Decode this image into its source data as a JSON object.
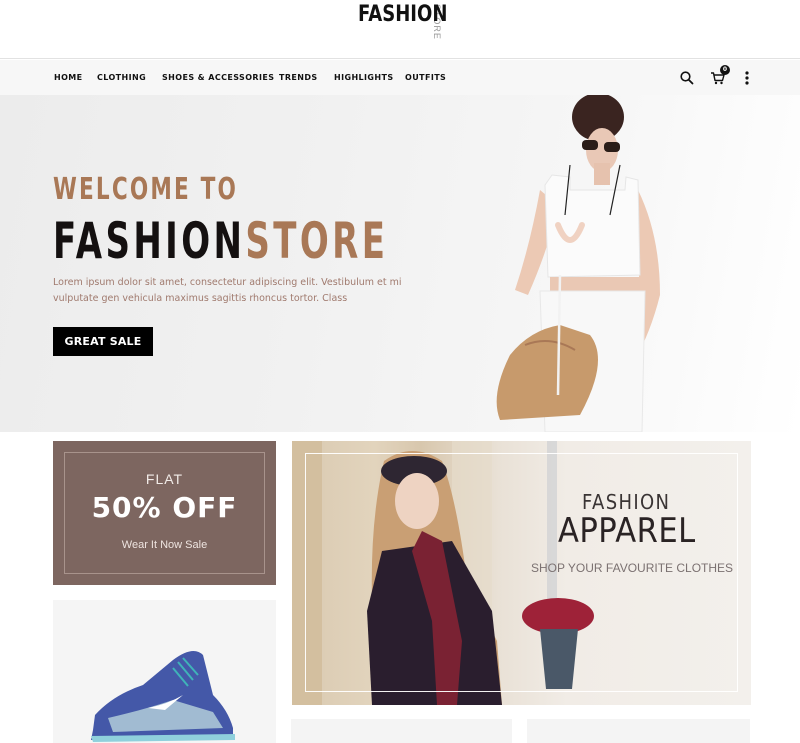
{
  "brand": {
    "logo_main": "FASHION",
    "logo_sub": "STORE"
  },
  "nav": {
    "items": [
      {
        "label": "HOME"
      },
      {
        "label": "CLOTHING"
      },
      {
        "label": "SHOES & ACCESSORIES"
      },
      {
        "label": "TRENDS"
      },
      {
        "label": "HIGHLIGHTS"
      },
      {
        "label": "OUTFITS"
      }
    ],
    "icons": {
      "search": "search-icon",
      "cart": "cart-icon",
      "more": "more-vertical-icon"
    },
    "cart_count": "0"
  },
  "hero": {
    "welcome": "WELCOME TO",
    "title_part1": "FASHION",
    "title_part2": "STORE",
    "description": "Lorem ipsum dolor sit amet, consectetur adipiscing elit. Vestibulum et mi vulputate gen vehicula maximus sagittis rhoncus tortor. Class",
    "button_label": "GREAT SALE"
  },
  "promos": {
    "flat": {
      "line1": "FLAT",
      "line2": "50% OFF",
      "line3": "Wear It Now Sale"
    },
    "apparel": {
      "line1": "FASHION",
      "line2": "APPAREL",
      "line3": "SHOP YOUR FAVOURITE CLOTHES"
    }
  },
  "colors": {
    "accent": "#a97856",
    "promo_bg": "#7d6660",
    "button_bg": "#000000",
    "nav_bg": "#f7f7f7"
  }
}
